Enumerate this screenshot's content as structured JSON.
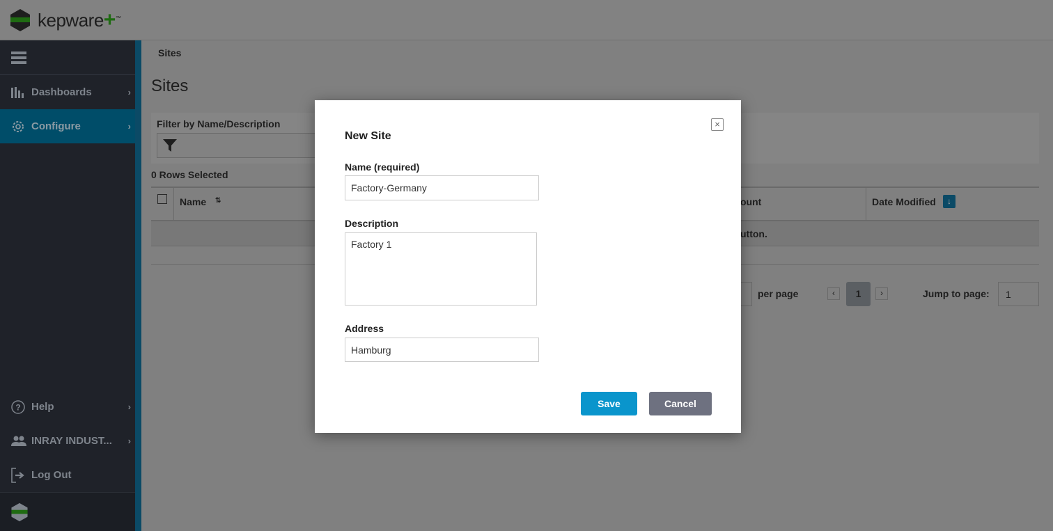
{
  "header": {
    "logo_text": "kepware",
    "logo_plus": "+",
    "logo_tm": "™"
  },
  "sidebar": {
    "items": [
      {
        "label": "Dashboards",
        "icon": "bar-chart-icon"
      },
      {
        "label": "Configure",
        "icon": "gear-icon",
        "active": true
      }
    ],
    "bottom_items": [
      {
        "label": "Help",
        "icon": "help-circle-icon"
      },
      {
        "label": "INRAY INDUST...",
        "icon": "users-icon"
      },
      {
        "label": "Log Out",
        "icon": "logout-icon"
      }
    ]
  },
  "main": {
    "breadcrumb": "Sites",
    "title": "Sites",
    "filter_label": "Filter by Name/Description",
    "rows_selected": "0 Rows Selected",
    "columns": {
      "name": "Name",
      "count_partial": "ount",
      "date_modified": "Date Modified"
    },
    "empty_partial": "utton.",
    "pagination": {
      "per_page_label": "per page",
      "current_page": "1",
      "jump_label": "Jump to page:",
      "jump_value": "1"
    }
  },
  "modal": {
    "title": "New Site",
    "name_label": "Name (required)",
    "name_value": "Factory-Germany",
    "description_label": "Description",
    "description_value": "Factory 1",
    "address_label": "Address",
    "address_value": "Hamburg",
    "save": "Save",
    "cancel": "Cancel"
  },
  "colors": {
    "accent": "#0a95cc",
    "cancel": "#6e7180",
    "brand_green": "#1f6b12"
  }
}
